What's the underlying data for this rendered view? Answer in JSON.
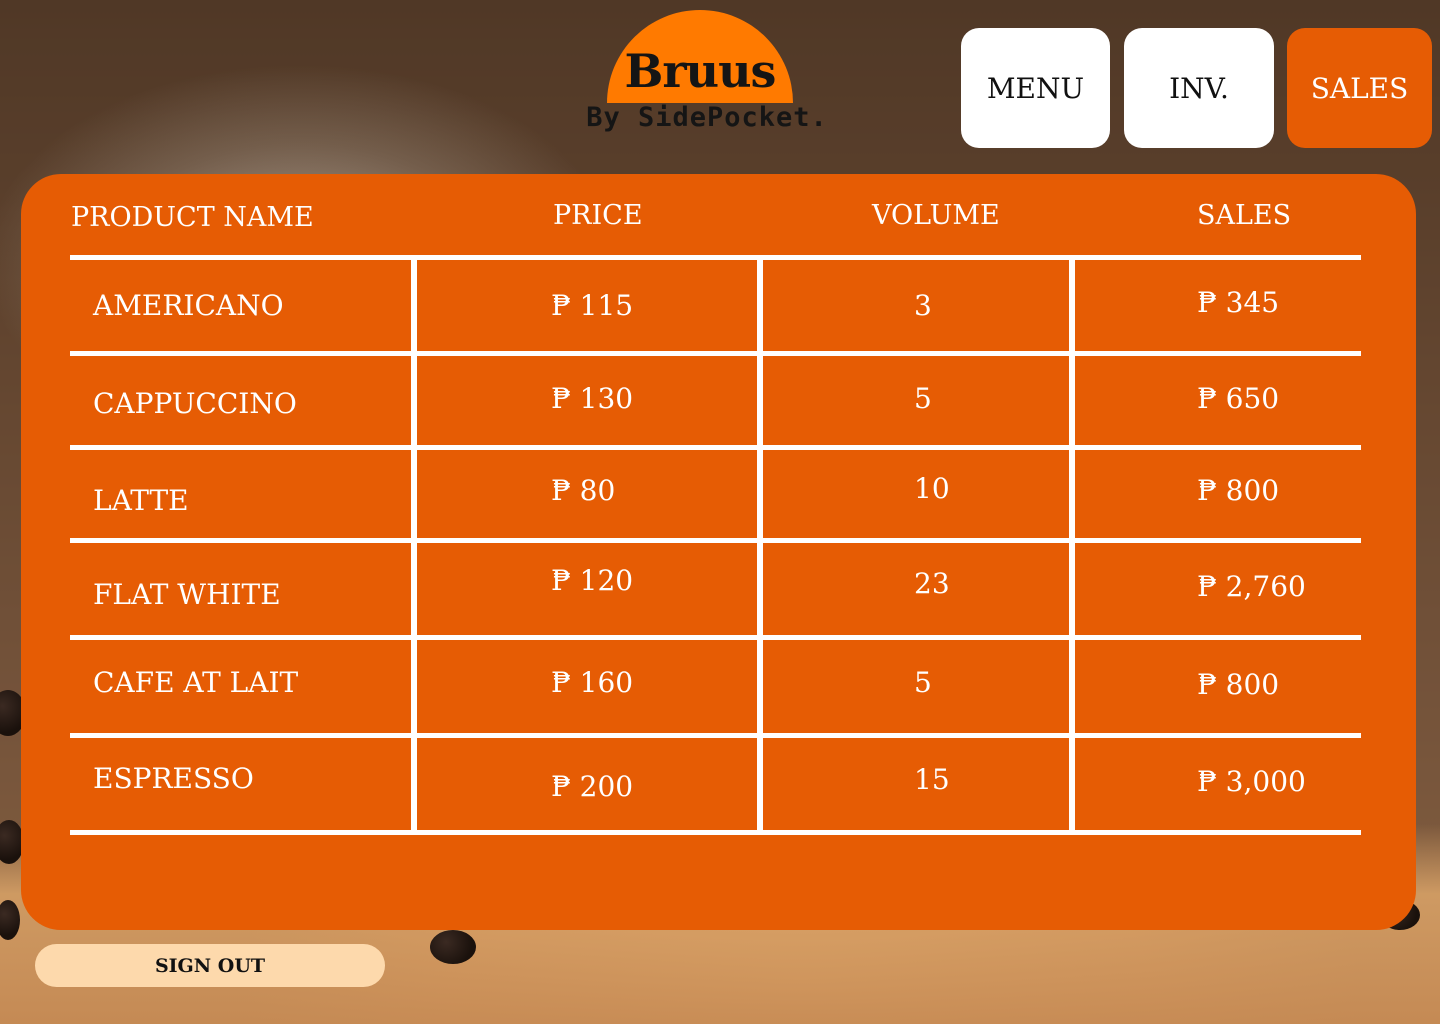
{
  "brand": {
    "name": "Bruus",
    "tagline": "By SidePocket.",
    "accent": "#ff7a00"
  },
  "nav": {
    "menu_label": "MENU",
    "inv_label": "INV.",
    "sales_label": "SALES",
    "active": "SALES"
  },
  "table": {
    "headers": {
      "name": "PRODUCT NAME",
      "price": "PRICE",
      "volume": "VOLUME",
      "sales": "SALES"
    },
    "rows": [
      {
        "name": "AMERICANO",
        "price": "₱ 115",
        "volume": "3",
        "sales": "₱ 345"
      },
      {
        "name": "CAPPUCCINO",
        "price": "₱ 130",
        "volume": "5",
        "sales": "₱ 650"
      },
      {
        "name": "LATTE",
        "price": "₱ 80",
        "volume": "10",
        "sales": "₱ 800"
      },
      {
        "name": "FLAT WHITE",
        "price": "₱ 120",
        "volume": "23",
        "sales": "₱ 2,760"
      },
      {
        "name": "CAFE AT LAIT",
        "price": "₱ 160",
        "volume": "5",
        "sales": "₱ 800"
      },
      {
        "name": "ESPRESSO",
        "price": "₱ 200",
        "volume": "15",
        "sales": "₱ 3,000"
      }
    ]
  },
  "footer": {
    "signout_label": "SIGN OUT"
  },
  "colors": {
    "panel": "#e65c04",
    "signout_bg": "#fdd9ac",
    "nav_bg": "#ffffff"
  }
}
